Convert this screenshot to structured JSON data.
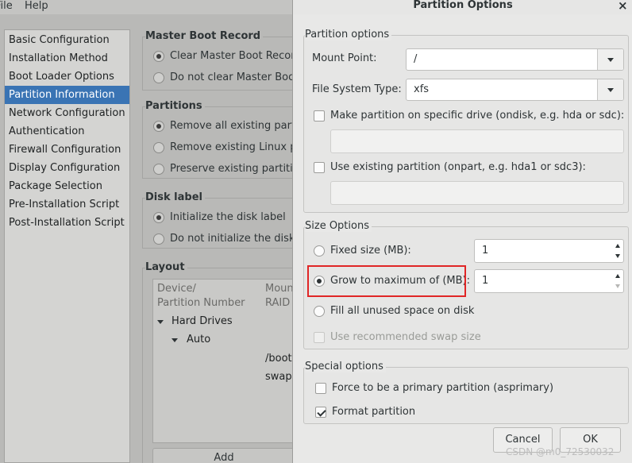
{
  "menubar": {
    "file": "File",
    "help": "Help"
  },
  "sidebar": {
    "items": [
      {
        "label": "Basic Configuration",
        "selected": false
      },
      {
        "label": "Installation Method",
        "selected": false
      },
      {
        "label": "Boot Loader Options",
        "selected": false
      },
      {
        "label": "Partition Information",
        "selected": true
      },
      {
        "label": "Network Configuration",
        "selected": false
      },
      {
        "label": "Authentication",
        "selected": false
      },
      {
        "label": "Firewall Configuration",
        "selected": false
      },
      {
        "label": "Display Configuration",
        "selected": false
      },
      {
        "label": "Package Selection",
        "selected": false
      },
      {
        "label": "Pre-Installation Script",
        "selected": false
      },
      {
        "label": "Post-Installation Script",
        "selected": false
      }
    ]
  },
  "mbr": {
    "title": "Master Boot Record",
    "options": [
      "Clear Master Boot Record",
      "Do not clear Master Boot Record"
    ],
    "selected": 0
  },
  "partitions": {
    "title": "Partitions",
    "options": [
      "Remove all existing partitions",
      "Remove existing Linux partitions",
      "Preserve existing partitions"
    ],
    "selected": 0
  },
  "disk_label": {
    "title": "Disk label",
    "options": [
      "Initialize the disk label",
      "Do not initialize the disk label"
    ],
    "selected": 0
  },
  "layout": {
    "title": "Layout",
    "col_device_line1": "Device/",
    "col_device_line2": "Partition Number",
    "col_mount_line1": "Mount Point/",
    "col_mount_line2": "RAID",
    "tree_hard_drives": "Hard Drives",
    "tree_auto": "Auto",
    "mounts": [
      "/boot",
      "swap"
    ],
    "add_label": "Add"
  },
  "dialog": {
    "title": "Partition Options",
    "close_glyph": "×",
    "partition_options": {
      "title": "Partition options",
      "mount_point_label": "Mount Point:",
      "mount_point_value": "/",
      "fs_type_label": "File System Type:",
      "fs_type_value": "xfs",
      "ondisk_label": "Make partition on specific drive (ondisk, e.g. hda or sdc):",
      "ondisk_checked": false,
      "ondisk_value": "",
      "onpart_label": "Use existing partition (onpart, e.g. hda1 or sdc3):",
      "onpart_checked": false,
      "onpart_value": ""
    },
    "size_options": {
      "title": "Size Options",
      "fixed_label": "Fixed size (MB):",
      "fixed_value": "1",
      "grow_label": "Grow to maximum of (MB):",
      "grow_value": "1",
      "fill_label": "Fill all unused space on disk",
      "swap_label": "Use recommended swap size",
      "selected": "grow"
    },
    "special_options": {
      "title": "Special options",
      "primary_label": "Force to be a primary partition (asprimary)",
      "primary_checked": false,
      "format_label": "Format partition",
      "format_checked": true
    },
    "buttons": {
      "cancel": "Cancel",
      "ok": "OK"
    }
  },
  "watermark": "CSDN @m0_72530032",
  "colors": {
    "selection": "#3a74b4",
    "highlight": "#e02626"
  }
}
